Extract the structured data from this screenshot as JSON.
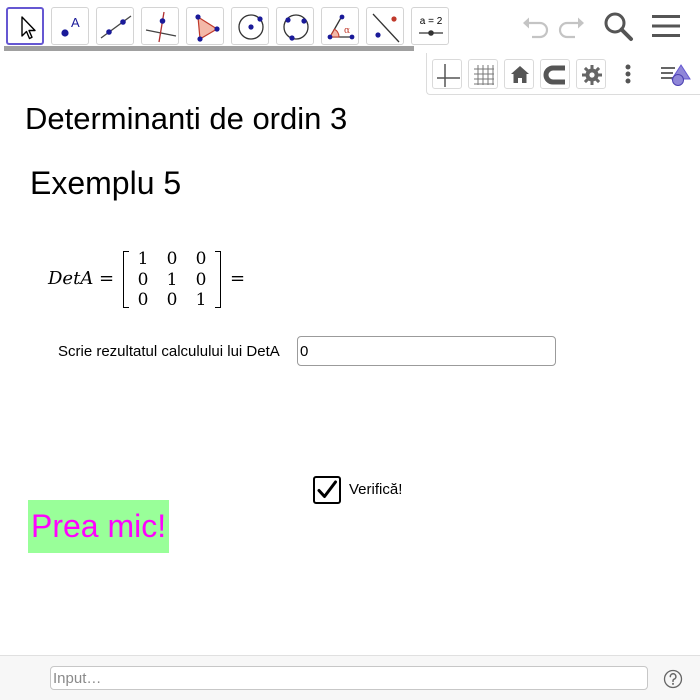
{
  "toolbar": {
    "tools": [
      {
        "name": "move-tool",
        "icon": "arrow-cursor-icon",
        "active": true
      },
      {
        "name": "point-tool",
        "icon": "point-icon",
        "label": "A"
      },
      {
        "name": "line-tool",
        "icon": "line-through-points-icon"
      },
      {
        "name": "perpendicular-line-tool",
        "icon": "perpendicular-line-icon"
      },
      {
        "name": "polygon-tool",
        "icon": "polygon-icon"
      },
      {
        "name": "circle-center-point-tool",
        "icon": "circle-center-point-icon"
      },
      {
        "name": "circle-three-points-tool",
        "icon": "circle-three-points-icon"
      },
      {
        "name": "angle-tool",
        "icon": "angle-icon",
        "label": "α"
      },
      {
        "name": "reflect-about-line-tool",
        "icon": "reflect-line-icon"
      },
      {
        "name": "slider-tool",
        "icon": "slider-icon",
        "label": "a = 2"
      }
    ],
    "right_icons": [
      "undo-icon",
      "redo-icon",
      "search-icon",
      "menu-icon"
    ]
  },
  "stylebar": {
    "buttons": [
      "axes-icon",
      "grid-icon",
      "home-icon",
      "magnet-icon",
      "gear-icon",
      "more-vert-icon",
      "style-bar-toggle-icon"
    ]
  },
  "content": {
    "title": "Determinanti de ordin 3",
    "subtitle": "Exemplu 5",
    "formula": {
      "lhs": "DetA =",
      "matrix": [
        [
          "1",
          "0",
          "0"
        ],
        [
          "0",
          "1",
          "0"
        ],
        [
          "0",
          "0",
          "1"
        ]
      ],
      "rhs": "="
    },
    "prompt": "Scrie rezultatul calculului lui DetA",
    "answer_value": "0",
    "checkbox": {
      "label": "Verifică!",
      "checked": true
    },
    "feedback": {
      "text": "Prea mic!",
      "background": "#99ff99",
      "color": "#ff00ff"
    }
  },
  "input_bar": {
    "placeholder": "Input…"
  },
  "colors": {
    "accent": "#6557d2",
    "point": "#1a1a99"
  }
}
